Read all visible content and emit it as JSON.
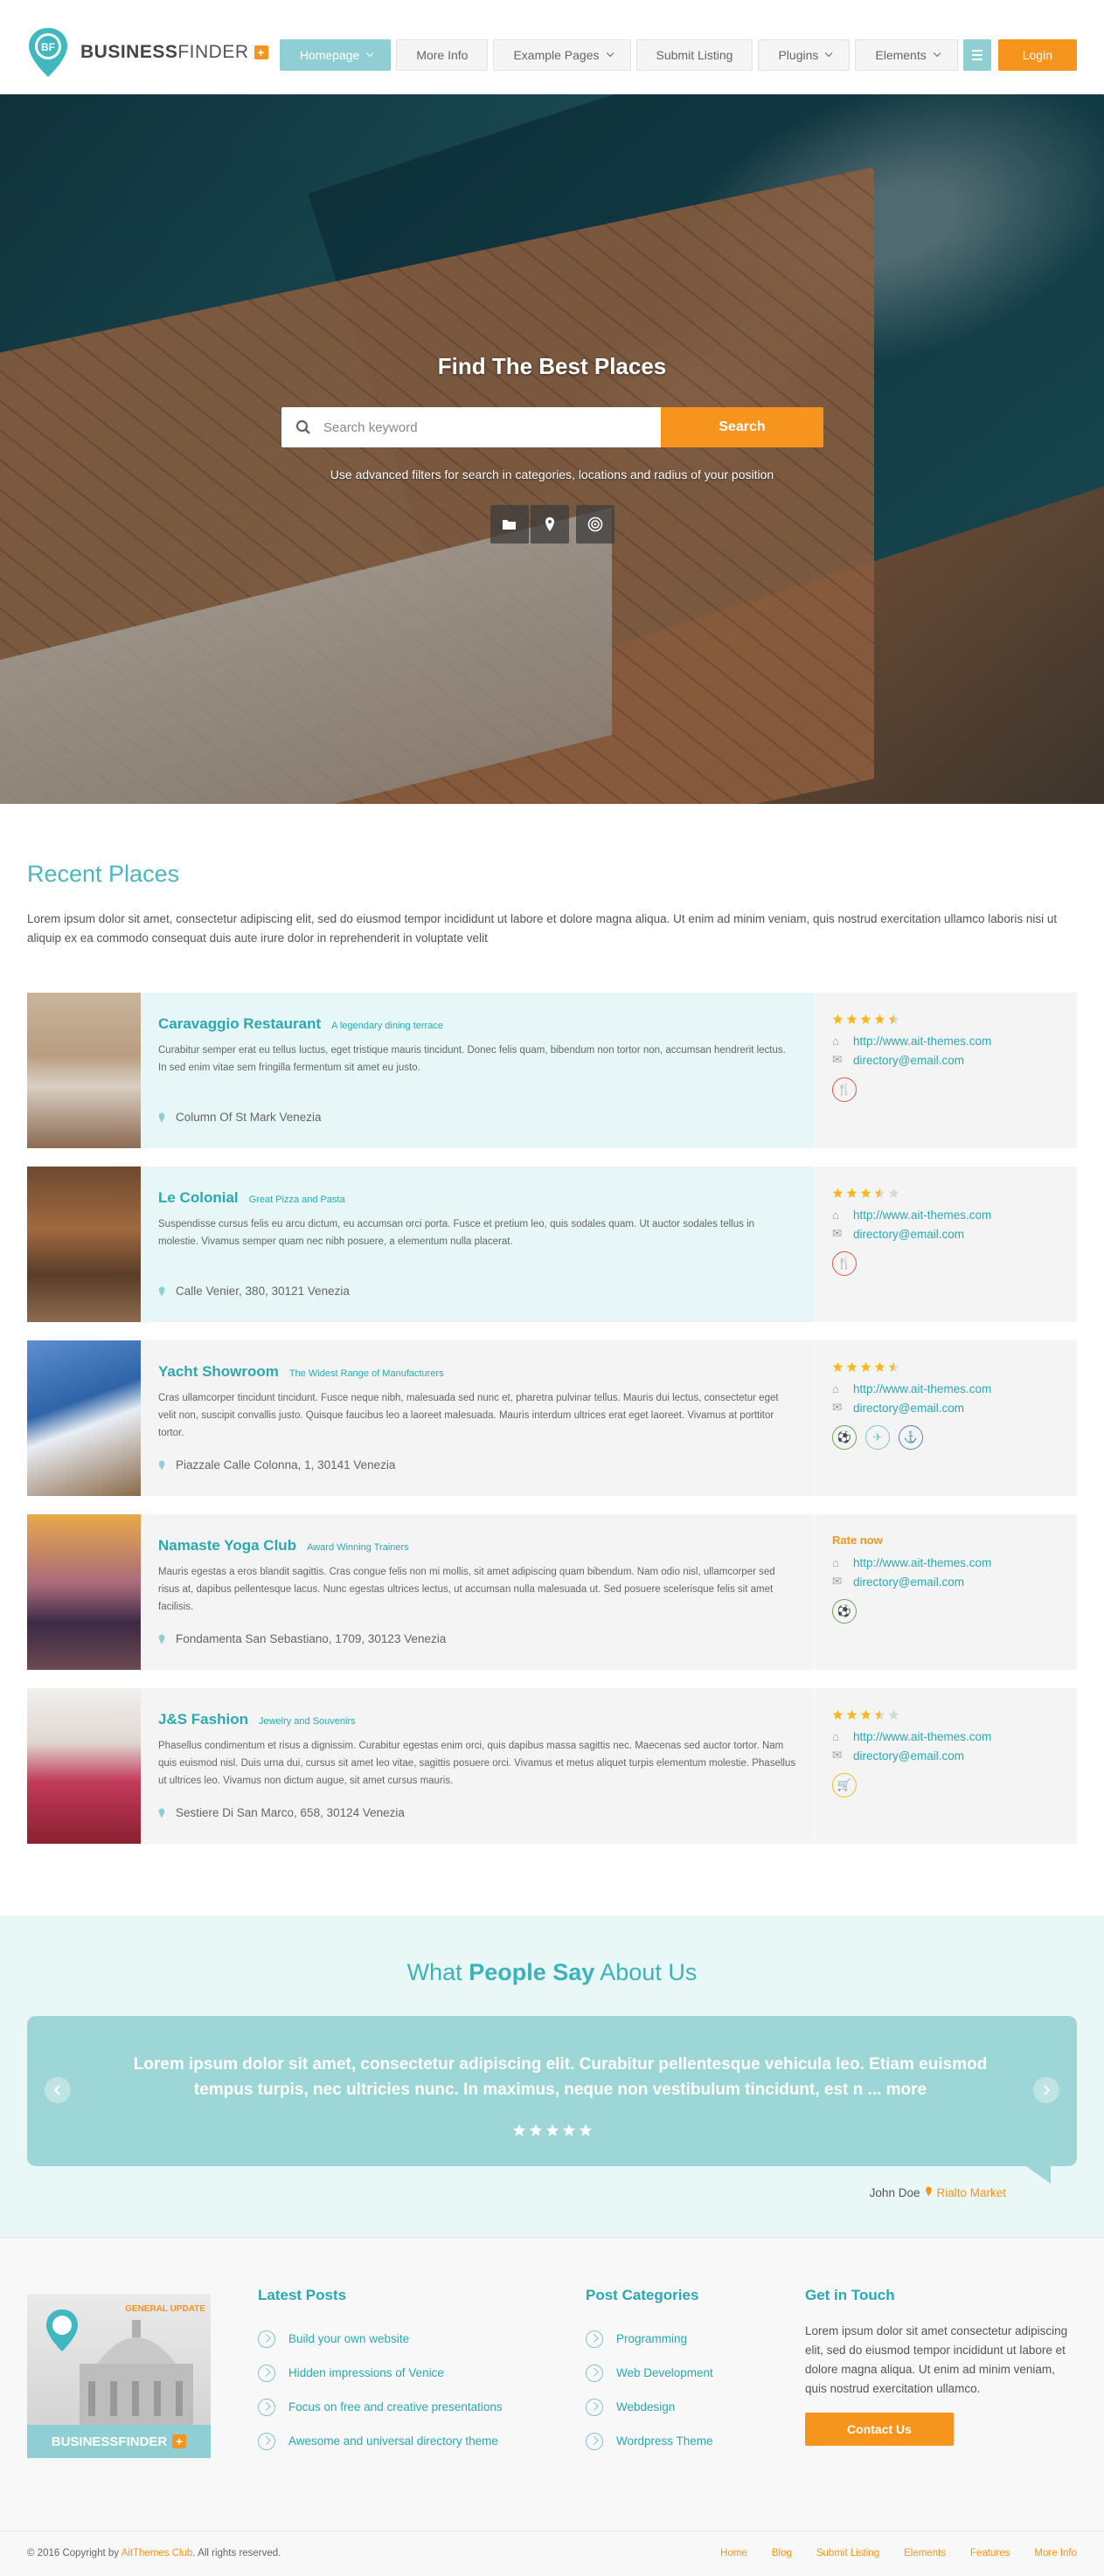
{
  "header": {
    "logo_bold": "BUSINESS",
    "logo_light": "FINDER",
    "logo_initials": "BF",
    "logo_plus": "+",
    "nav": [
      {
        "label": "Homepage",
        "dropdown": true,
        "active": true
      },
      {
        "label": "More Info",
        "dropdown": false,
        "active": false
      },
      {
        "label": "Example Pages",
        "dropdown": true,
        "active": false
      },
      {
        "label": "Submit Listing",
        "dropdown": false,
        "active": false
      },
      {
        "label": "Plugins",
        "dropdown": true,
        "active": false
      },
      {
        "label": "Elements",
        "dropdown": true,
        "active": false
      }
    ],
    "menu_icon": "hamburger-icon",
    "login_label": "Login"
  },
  "hero": {
    "title": "Find The Best Places",
    "search_placeholder": "Search keyword",
    "search_button": "Search",
    "hint": "Use advanced filters for search in categories, locations and radius of your position",
    "filter_icons": [
      "folder-icon",
      "location-pin-icon",
      "radius-target-icon"
    ]
  },
  "recent": {
    "title": "Recent Places",
    "intro": "Lorem ipsum dolor sit amet, consectetur adipiscing elit, sed do eiusmod tempor incididunt ut labore et dolore magna aliqua. Ut enim ad minim veniam, quis nostrud exercitation ullamco laboris nisi ut aliquip ex ea commodo consequat duis aute irure dolor in reprehenderit in voluptate velit",
    "places": [
      {
        "name": "Caravaggio Restaurant",
        "tagline": "A legendary dining terrace",
        "desc": "Curabitur semper erat eu tellus luctus, eget tristique mauris tincidunt. Donec felis quam, bibendum non tortor non, accumsan hendrerit lectus. In sed enim vitae sem fringilla fermentum sit amet eu justo.",
        "address": "Column Of St Mark Venezia",
        "rating": 4.5,
        "rate_now": "",
        "url": "http://www.ait-themes.com",
        "email": "directory@email.com",
        "featured": true,
        "categories": [
          {
            "icon": "restaurant-icon",
            "color": "#e0583e"
          }
        ]
      },
      {
        "name": "Le Colonial",
        "tagline": "Great Pizza and Pasta",
        "desc": "Suspendisse cursus felis eu arcu dictum, eu accumsan orci porta. Fusce et pretium leo, quis sodales quam. Ut auctor sodales tellus in molestie. Vivamus semper quam nec nibh posuere, a elementum nulla placerat.",
        "address": "Calle Venier, 380, 30121 Venezia",
        "rating": 3.5,
        "rate_now": "",
        "url": "http://www.ait-themes.com",
        "email": "directory@email.com",
        "featured": true,
        "categories": [
          {
            "icon": "restaurant-icon",
            "color": "#e0583e"
          }
        ]
      },
      {
        "name": "Yacht Showroom",
        "tagline": "The Widest Range of Manufacturers",
        "desc": "Cras ullamcorper tincidunt tincidunt. Fusce neque nibh, malesuada sed nunc et, pharetra pulvinar tellus. Mauris dui lectus, consectetur eget velit non, suscipit convallis justo. Quisque faucibus leo a laoreet malesuada. Mauris interdum ultrices erat eget laoreet. Vivamus at porttitor tortor.",
        "address": "Piazzale Calle Colonna, 1, 30141 Venezia",
        "rating": 4.5,
        "rate_now": "",
        "url": "http://www.ait-themes.com",
        "email": "directory@email.com",
        "featured": false,
        "categories": [
          {
            "icon": "sport-icon",
            "color": "#6aa84f"
          },
          {
            "icon": "airplane-icon",
            "color": "#7cc6cc"
          },
          {
            "icon": "anchor-icon",
            "color": "#5b7fc9"
          }
        ]
      },
      {
        "name": "Namaste Yoga Club",
        "tagline": "Award Winning Trainers",
        "desc": "Mauris egestas a eros blandit sagittis. Cras congue felis non mi mollis, sit amet adipiscing quam bibendum. Nam odio nisl, ullamcorper sed risus at, dapibus pellentesque lacus. Nunc egestas ultrices lectus, ut accumsan nulla malesuada ut. Sed posuere scelerisque felis sit amet facilisis.",
        "address": "Fondamenta San Sebastiano, 1709, 30123 Venezia",
        "rating": 0,
        "rate_now": "Rate now",
        "url": "http://www.ait-themes.com",
        "email": "directory@email.com",
        "featured": false,
        "categories": [
          {
            "icon": "sport-icon",
            "color": "#6aa84f"
          }
        ]
      },
      {
        "name": "J&S Fashion",
        "tagline": "Jewelry and Souvenirs",
        "desc": "Phasellus condimentum et risus a dignissim. Curabitur egestas enim orci, quis dapibus massa sagittis nec. Maecenas sed auctor tortor. Nam quis euismod nisl. Duis urna dui, cursus sit amet leo vitae, sagittis posuere orci. Vivamus et metus aliquet turpis elementum molestie. Phasellus ut ultrices leo. Vivamus non dictum augue, sit amet cursus mauris.",
        "address": "Sestiere Di San Marco, 658, 30124 Venezia",
        "rating": 3.5,
        "rate_now": "",
        "url": "http://www.ait-themes.com",
        "email": "directory@email.com",
        "featured": false,
        "categories": [
          {
            "icon": "shopping-cart-icon",
            "color": "#e8c21a"
          }
        ]
      }
    ]
  },
  "testimonials": {
    "title_start": "What ",
    "title_bold": "People Say",
    "title_end": " About Us",
    "quote": "Lorem ipsum dolor sit amet, consectetur adipiscing elit. Curabitur pellentesque vehicula leo. Etiam euismod tempus turpis, nec ultricies nunc. In maximus, neque non vestibulum tincidunt, est n",
    "more": "... more",
    "stars": 5,
    "author": "John Doe",
    "author_place": "Rialto Market"
  },
  "footer": {
    "logo_badge": "GENERAL UPDATE",
    "logo_text": "BUSINESSFINDER",
    "logo_plus": "+",
    "latest_posts_title": "Latest Posts",
    "latest_posts": [
      "Build your own website",
      "Hidden impressions of Venice",
      "Focus on free and creative presentations",
      "Awesome and universal directory theme"
    ],
    "categories_title": "Post Categories",
    "categories": [
      "Programming",
      "Web Development",
      "Webdesign",
      "Wordpress Theme"
    ],
    "touch_title": "Get in Touch",
    "touch_text": "Lorem ipsum dolor sit amet consectetur adipiscing elit, sed do eiusmod tempor incididunt ut labore et dolore magna aliqua. Ut enim ad minim veniam, quis nostrud exercitation ullamco.",
    "contact_button": "Contact Us",
    "copyright_start": "© 2016 Copyright by ",
    "copyright_brand": "AitThemes Club",
    "copyright_end": ". All rights reserved.",
    "bottom_nav": [
      "Home",
      "Blog",
      "Submit Listing",
      "Elements",
      "Features",
      "More Info"
    ]
  },
  "colors": {
    "accent": "#2aa9b2",
    "orange": "#f7941d",
    "nav_active": "#8fcfd3",
    "testimonial_card": "#9dd6d6"
  }
}
